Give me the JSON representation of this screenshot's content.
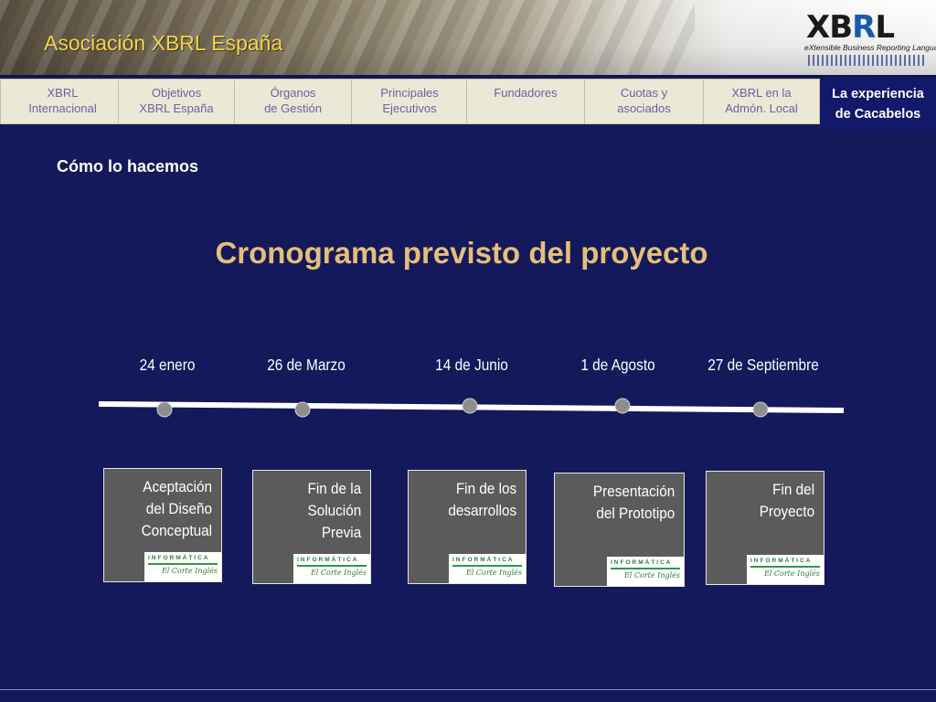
{
  "header": {
    "title": "Asociación XBRL España",
    "logo": {
      "wordmark": "XBRL",
      "tagline": "eXtensible Business Reporting Language"
    }
  },
  "nav": {
    "tabs": [
      {
        "label": "XBRL\nInternacional",
        "active": false
      },
      {
        "label": "Objetivos\nXBRL España",
        "active": false
      },
      {
        "label": "Órganos\nde Gestión",
        "active": false
      },
      {
        "label": "Principales\nEjecutivos",
        "active": false
      },
      {
        "label": "Fundadores",
        "active": false
      },
      {
        "label": "Cuotas y\nasociados",
        "active": false
      },
      {
        "label": "XBRL en la\nAdmón. Local",
        "active": false
      },
      {
        "label": "La experiencia\nde Cacabelos",
        "active": true
      }
    ]
  },
  "section_label": "Cómo lo hacemos",
  "title": "Cronograma previsto del proyecto",
  "timeline": {
    "dates": [
      "24 enero",
      "26 de Marzo",
      "14 de Junio",
      "1 de Agosto",
      "27 de Septiembre"
    ],
    "milestones": [
      "Aceptación\ndel Diseño\nConceptual",
      "Fin de la\nSolución\nPrevia",
      "Fin de los\ndesarrollos",
      "Presentación\ndel Prototipo",
      "Fin del\nProyecto"
    ],
    "badge": {
      "top": "INFORMÁTICA",
      "sub": "El Corte Inglés"
    }
  },
  "colors": {
    "background": "#13195a",
    "title": "#e6be78",
    "header_title": "#f2d34e",
    "tab_bg": "#ece8d6",
    "tab_text": "#6c5fa6",
    "active_tab_bg": "#12196a",
    "card_bg": "#5b5b5b",
    "badge_green": "#2c7a3c"
  }
}
